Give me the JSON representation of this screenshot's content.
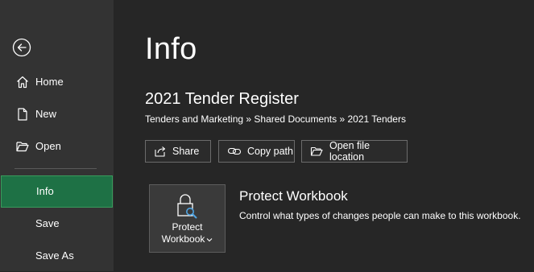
{
  "sidebar": {
    "back_icon": "back-arrow-icon",
    "items": [
      {
        "label": "Home",
        "icon": "home-icon"
      },
      {
        "label": "New",
        "icon": "new-document-icon"
      },
      {
        "label": "Open",
        "icon": "open-folder-icon"
      },
      {
        "label": "Info",
        "active": true
      },
      {
        "label": "Save"
      },
      {
        "label": "Save As"
      }
    ],
    "active_color": "#1e7145"
  },
  "main": {
    "title": "Info",
    "document_name": "2021 Tender Register",
    "breadcrumb": "Tenders and Marketing » Shared Documents » 2021 Tenders",
    "actions": [
      {
        "label": "Share",
        "icon": "share-icon"
      },
      {
        "label": "Copy path",
        "icon": "link-icon"
      },
      {
        "label": "Open file location",
        "icon": "folder-icon"
      }
    ],
    "protect": {
      "tile_label_line1": "Protect",
      "tile_label_line2": "Workbook",
      "icon": "lock-search-icon",
      "heading": "Protect Workbook",
      "description": "Control what types of changes people can make to this workbook."
    }
  }
}
